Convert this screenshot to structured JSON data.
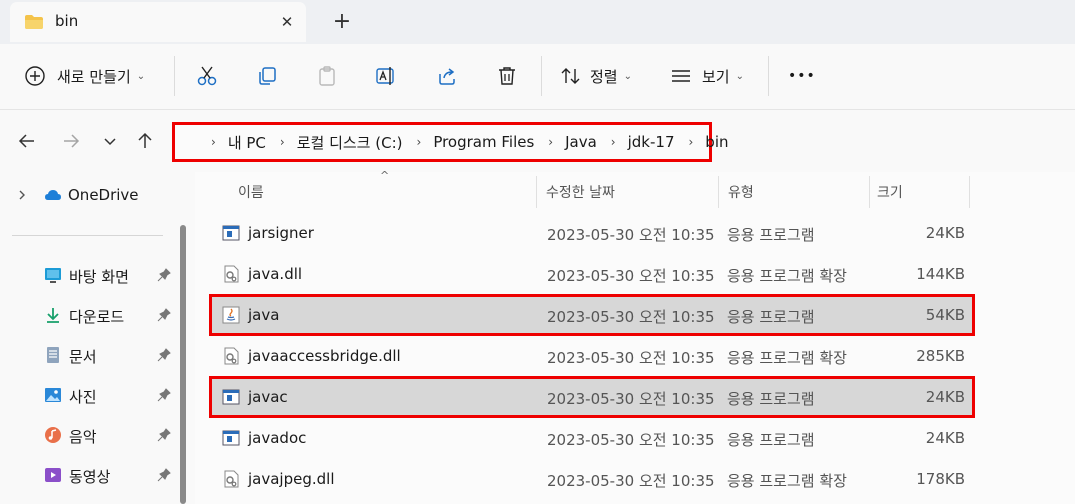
{
  "tab": {
    "title": "bin",
    "close_glyph": "✕",
    "new_tab_glyph": "+"
  },
  "toolbar": {
    "new_label": "새로 만들기",
    "sort_label": "정렬",
    "view_label": "보기",
    "more_glyph": "•••",
    "chevron": "⌄"
  },
  "address": {
    "crumbs": [
      "내 PC",
      "로컬 디스크 (C:)",
      "Program Files",
      "Java",
      "jdk-17",
      "bin"
    ],
    "separator": "›"
  },
  "sidebar": {
    "onedrive": "OneDrive",
    "items": [
      {
        "label": "바탕 화면",
        "icon": "desktop-icon"
      },
      {
        "label": "다운로드",
        "icon": "download-icon"
      },
      {
        "label": "문서",
        "icon": "documents-icon"
      },
      {
        "label": "사진",
        "icon": "pictures-icon"
      },
      {
        "label": "음악",
        "icon": "music-icon"
      },
      {
        "label": "동영상",
        "icon": "videos-icon"
      }
    ]
  },
  "columns": {
    "name": "이름",
    "date": "수정한 날짜",
    "type": "유형",
    "size": "크기",
    "sort_glyph": "^"
  },
  "files": [
    {
      "name": "jarsigner",
      "date": "2023-05-30 오전 10:35",
      "type": "응용 프로그램",
      "size": "24KB",
      "icon": "exe-icon"
    },
    {
      "name": "java.dll",
      "date": "2023-05-30 오전 10:35",
      "type": "응용 프로그램 확장",
      "size": "144KB",
      "icon": "dll-icon"
    },
    {
      "name": "java",
      "date": "2023-05-30 오전 10:35",
      "type": "응용 프로그램",
      "size": "54KB",
      "icon": "java-icon"
    },
    {
      "name": "javaaccessbridge.dll",
      "date": "2023-05-30 오전 10:35",
      "type": "응용 프로그램 확장",
      "size": "285KB",
      "icon": "dll-icon"
    },
    {
      "name": "javac",
      "date": "2023-05-30 오전 10:35",
      "type": "응용 프로그램",
      "size": "24KB",
      "icon": "exe-icon"
    },
    {
      "name": "javadoc",
      "date": "2023-05-30 오전 10:35",
      "type": "응용 프로그램",
      "size": "24KB",
      "icon": "exe-icon"
    },
    {
      "name": "javajpeg.dll",
      "date": "2023-05-30 오전 10:35",
      "type": "응용 프로그램 확장",
      "size": "178KB",
      "icon": "dll-icon"
    }
  ],
  "colors": {
    "highlight": "#e00000",
    "selected_row": "#d7d7d7",
    "folder": "#f4c34a",
    "onedrive": "#1e7fd8"
  }
}
